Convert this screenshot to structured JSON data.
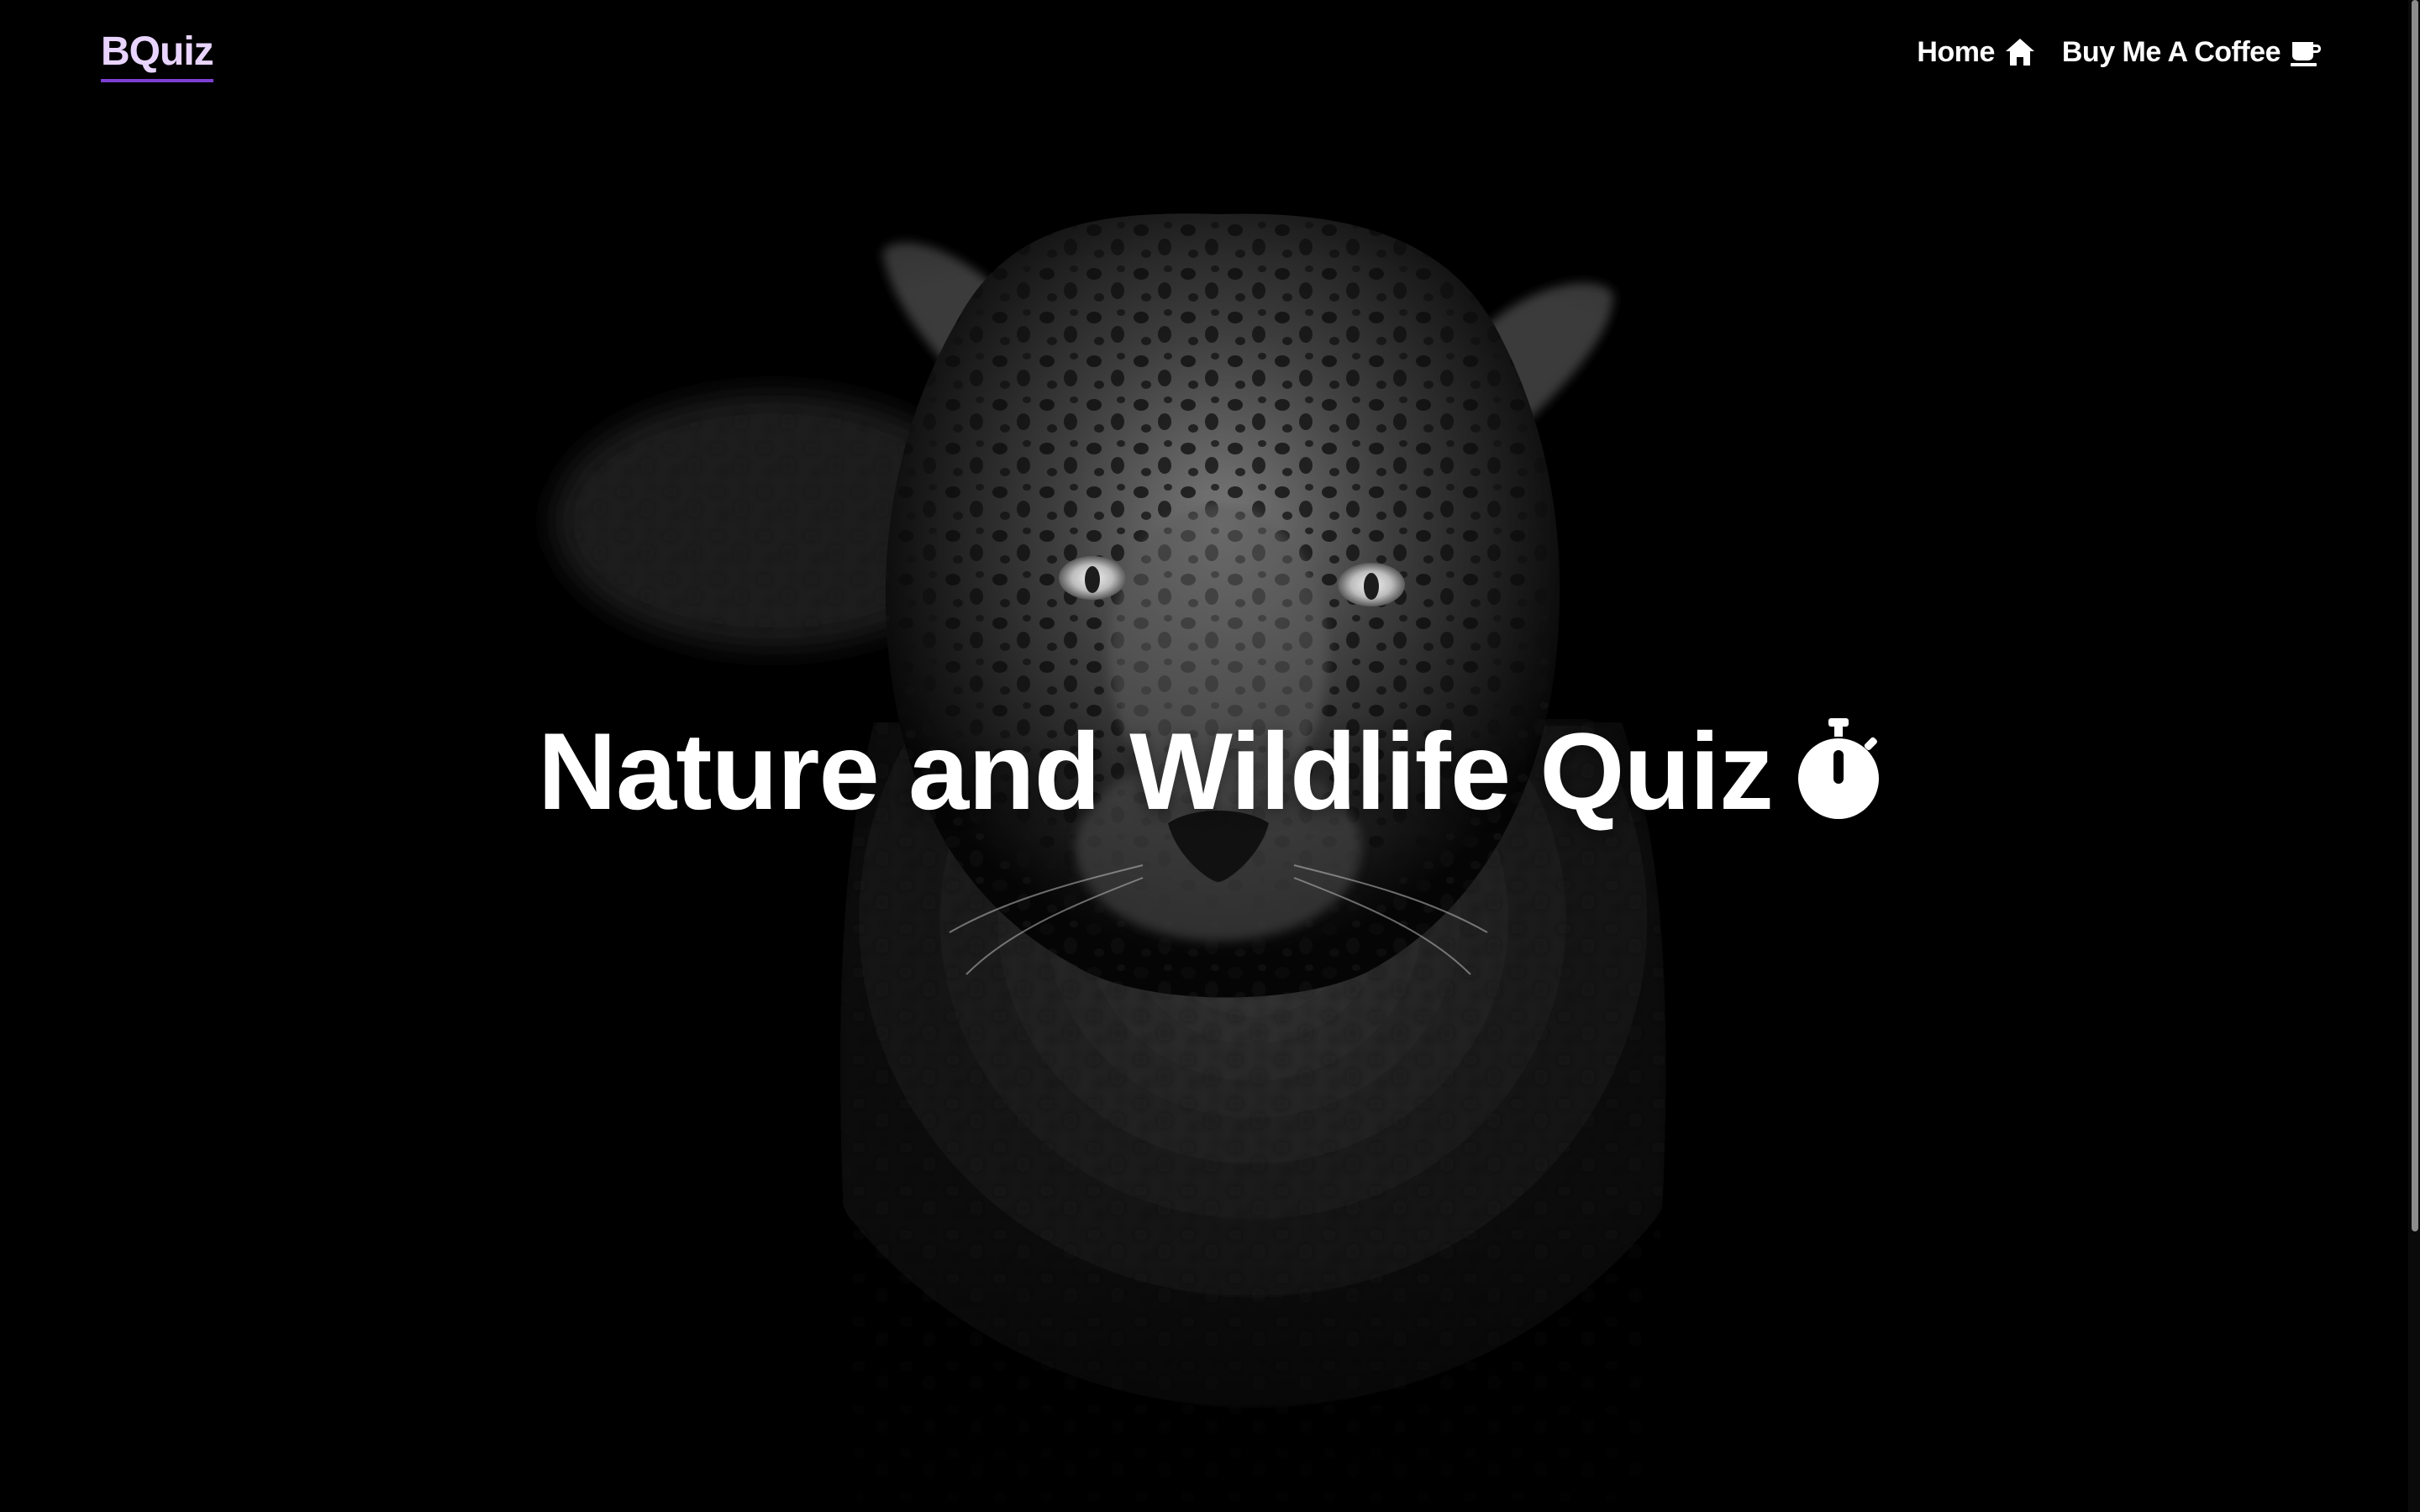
{
  "logo": {
    "text": "BQuiz",
    "color": "#e9d4ff",
    "underline_color": "#7d3fd1"
  },
  "nav": {
    "items": [
      {
        "label": "Home",
        "icon": "home-icon"
      },
      {
        "label": "Buy Me A Coffee",
        "icon": "coffee-cup-icon"
      }
    ]
  },
  "hero": {
    "title": "Nature and Wildlife Quiz",
    "title_icon": "stopwatch-icon",
    "background": "black-and-white leopard photo"
  },
  "colors": {
    "background": "#000000",
    "text": "#ffffff",
    "accent": "#7d3fd1"
  }
}
